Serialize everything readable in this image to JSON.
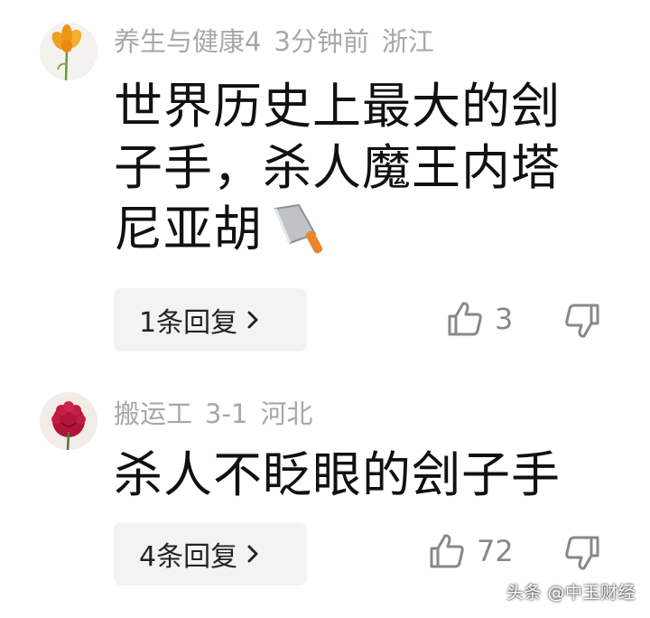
{
  "comments": [
    {
      "avatar_icon": "orange-flower-avatar-icon",
      "username": "养生与健康4",
      "time": "3分钟前",
      "location": "浙江",
      "text_lines": [
        "世界历史上最大的刽",
        "子手，杀人魔王内塔",
        "尼亚胡"
      ],
      "emoji_icon": "cleaver-knife-icon",
      "reply_label": "1条回复",
      "likes": "3"
    },
    {
      "avatar_icon": "red-rose-avatar-icon",
      "username": "搬运工",
      "time": "3-1",
      "location": "河北",
      "text_lines": [
        "杀人不眨眼的刽子手"
      ],
      "reply_label": "4条回复",
      "likes": "72"
    }
  ],
  "watermark": "头条 @中玉财经",
  "colors": {
    "meta_text": "#a8a8a8",
    "body_text": "#111111",
    "reply_bg": "#f3f3f3",
    "icon_gray": "#888888"
  }
}
